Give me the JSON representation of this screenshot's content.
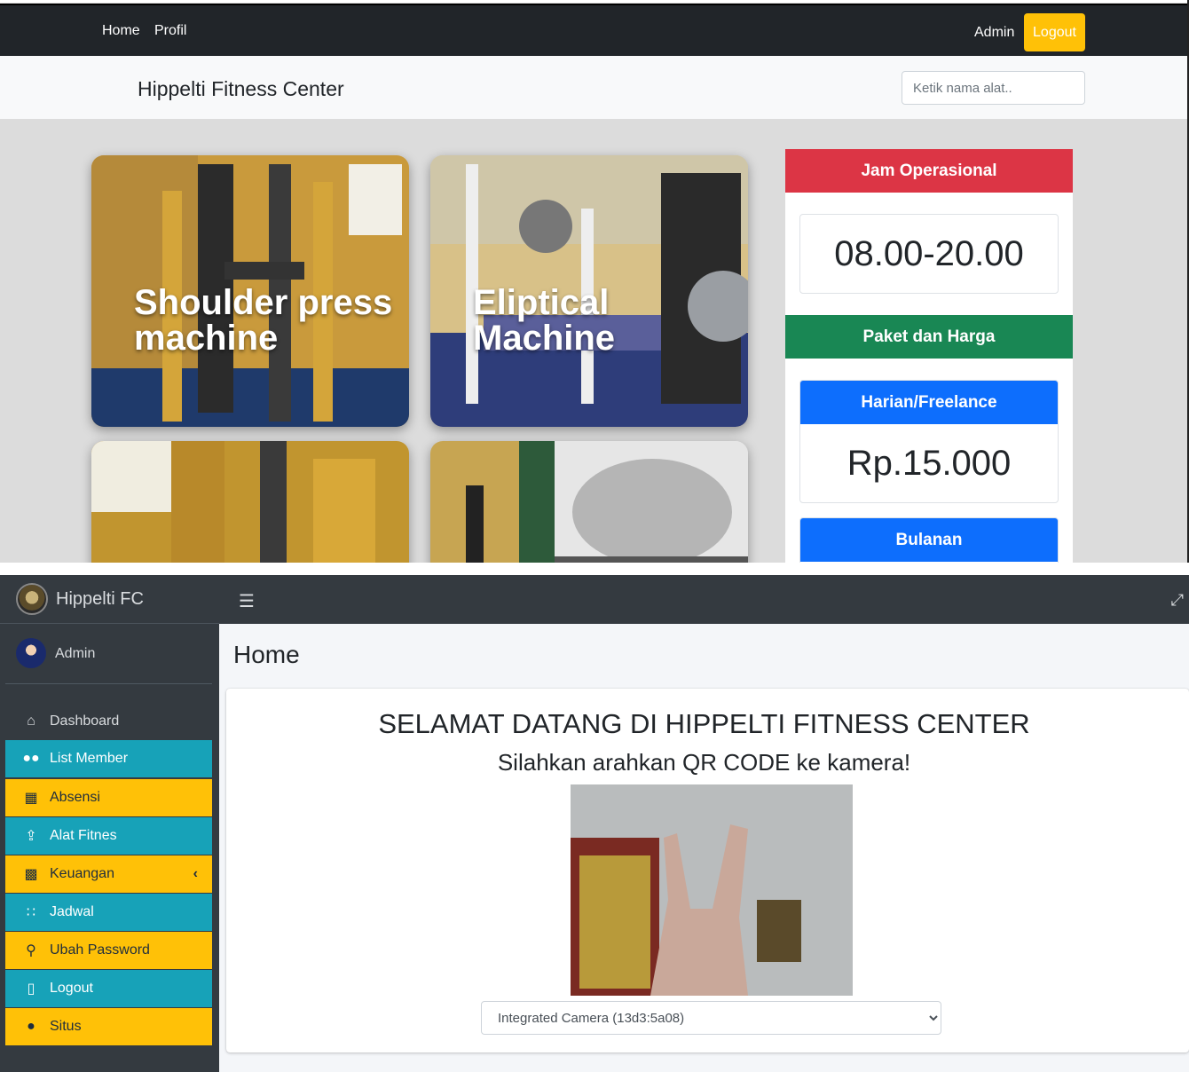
{
  "public_site": {
    "navbar": {
      "links": [
        "Home",
        "Profil"
      ],
      "user_label": "Admin",
      "logout_label": "Logout"
    },
    "header": {
      "title": "Hippelti Fitness Center",
      "search_placeholder": "Ketik nama alat.."
    },
    "equipment_cards": [
      {
        "title": "Shoulder press machine"
      },
      {
        "title": "Eliptical Machine"
      }
    ],
    "sidebar": {
      "hours_heading": "Jam Operasional",
      "hours_value": "08.00-20.00",
      "packages_heading": "Paket dan Harga",
      "packages": [
        {
          "name": "Harian/Freelance",
          "price": "Rp.15.000"
        },
        {
          "name": "Bulanan"
        }
      ]
    },
    "colors": {
      "navbar": "#212529",
      "danger": "#dc3545",
      "success": "#198754",
      "primary": "#0d6efd",
      "warning": "#ffc107"
    }
  },
  "admin_panel": {
    "brand": "Hippelti FC",
    "user_name": "Admin",
    "menu": [
      {
        "label": "Dashboard",
        "icon": "home-icon"
      },
      {
        "label": "List Member",
        "icon": "users-icon"
      },
      {
        "label": "Absensi",
        "icon": "table-icon"
      },
      {
        "label": "Alat Fitnes",
        "icon": "upload-icon"
      },
      {
        "label": "Keuangan",
        "icon": "money-icon"
      },
      {
        "label": "Jadwal",
        "icon": "grid-icon"
      },
      {
        "label": "Ubah Password",
        "icon": "key-icon"
      },
      {
        "label": "Logout",
        "icon": "file-icon"
      },
      {
        "label": "Situs",
        "icon": "globe-icon"
      }
    ],
    "page_title": "Home",
    "welcome_text": "SELAMAT DATANG DI HIPPELTI FITNESS CENTER",
    "instruction_text": "Silahkan arahkan QR CODE ke kamera!",
    "camera_selected": "Integrated Camera (13d3:5a08)",
    "colors": {
      "sidebar": "#343a40",
      "cyan": "#17a2b8",
      "yellow": "#ffc107"
    }
  }
}
